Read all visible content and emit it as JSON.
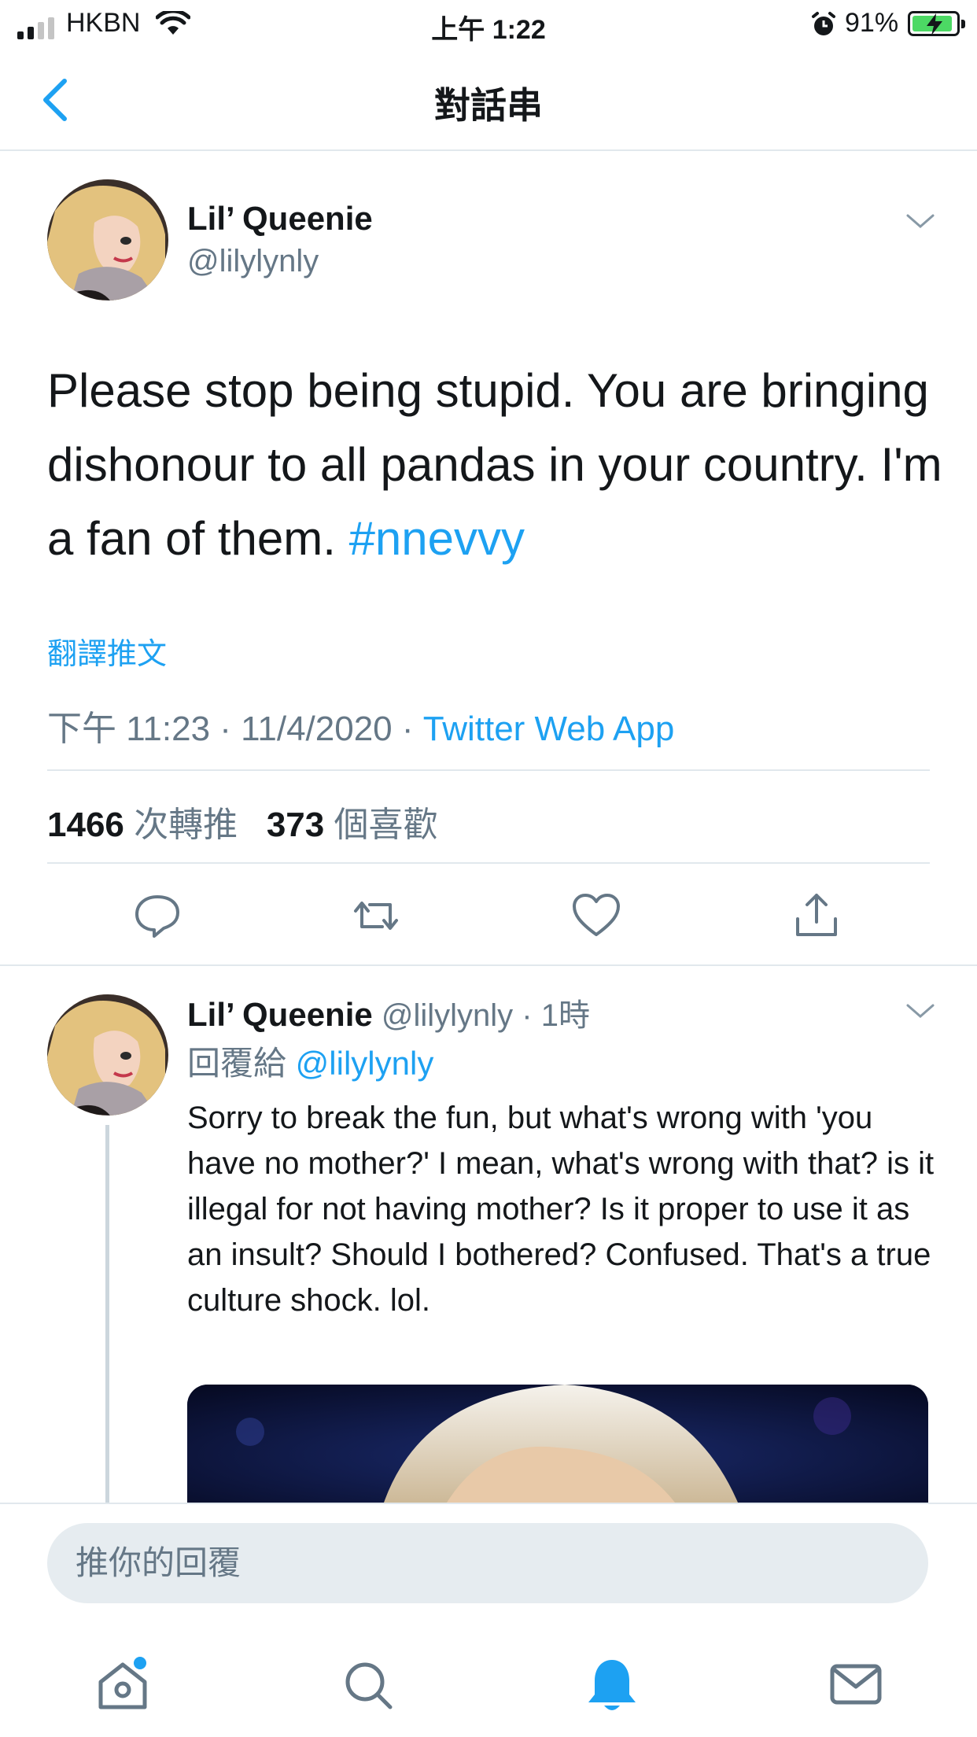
{
  "status_bar": {
    "carrier": "HKBN",
    "time": "上午 1:22",
    "battery": "91%"
  },
  "nav": {
    "title": "對話串",
    "back_icon": "chevron-left-icon"
  },
  "main_tweet": {
    "display_name": "Lil’ Queenie",
    "handle": "@lilylynly",
    "text_before": "Please stop being stupid. You are bringing dishonour to all pandas in your country. I'm a fan of them. ",
    "hashtag": "#nnevvy",
    "translate": "翻譯推文",
    "timestamp": "下午 11:23 · 11/4/2020 · ",
    "source": "Twitter Web App",
    "retweet_count": "1466",
    "retweet_label": " 次轉推",
    "like_count": "373",
    "like_label": " 個喜歡"
  },
  "actions": [
    "reply-icon",
    "retweet-icon",
    "like-icon",
    "share-icon"
  ],
  "reply_tweet": {
    "display_name": "Lil’ Queenie",
    "handle_time": " @lilylynly · 1時",
    "reply_to_label": "回覆給 ",
    "reply_to_handle": "@lilylynly",
    "text": "Sorry to break the fun, but what's wrong with 'you have no mother?' I mean, what's wrong with that? is it illegal for not having mother? Is it proper to use it as an insult? Should I bothered? Confused. That's a true culture shock. lol."
  },
  "composer": {
    "placeholder": "推你的回覆"
  },
  "tab_bar": [
    "home-icon",
    "search-icon",
    "notifications-icon",
    "messages-icon"
  ],
  "colors": {
    "accent": "#1da1f2",
    "secondary_text": "#657786",
    "divider": "#e1e8ed"
  }
}
